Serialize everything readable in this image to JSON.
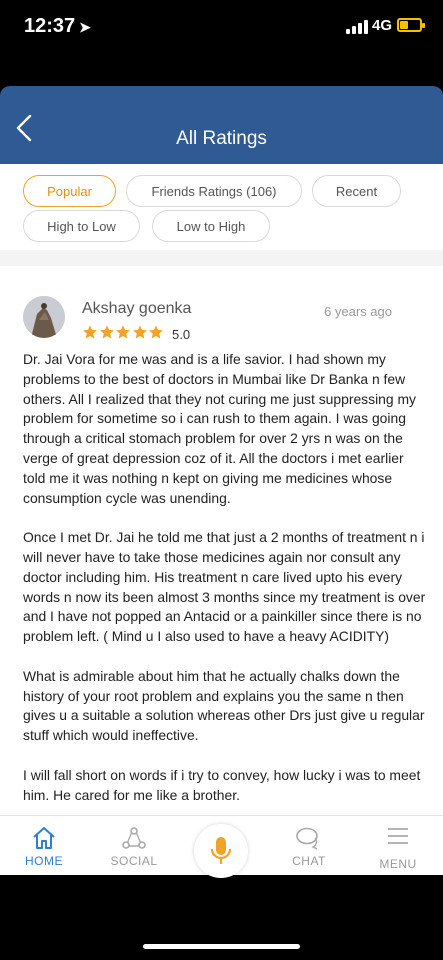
{
  "status_bar": {
    "time": "12:37",
    "network": "4G"
  },
  "header": {
    "title": "All Ratings"
  },
  "filters": [
    {
      "label": "Popular",
      "active": true
    },
    {
      "label": "Friends Ratings (106)",
      "active": false
    },
    {
      "label": "Recent",
      "active": false
    },
    {
      "label": "High to Low",
      "active": false
    },
    {
      "label": "Low to High",
      "active": false
    }
  ],
  "review": {
    "reviewer_name": "Akshay goenka",
    "date": "6 years ago",
    "rating": "5.0",
    "stars": 5,
    "paragraphs": [
      "Dr. Jai Vora for me was and is a life savior. I had shown my problems to the best of doctors in Mumbai like Dr Banka n few others. All I realized that they not curing me just suppressing my problem for sometime so i can rush to them again. I was going through a critical stomach problem for over 2 yrs n was on the verge of great depression coz of it. All the doctors i met earlier told me it was nothing n kept on giving me medicines whose consumption cycle was unending.",
      "Once I met Dr. Jai he told me that just a 2 months of treatment n i will never have to take those medicines again nor consult any doctor including him. His treatment n care lived upto his every words n now its been almost 3 months since my treatment is over and I have not popped an Antacid or a painkiller since there is no problem left. ( Mind u I also used to have a heavy ACIDITY)",
      "What is admirable about him that he actually chalks down the history of your root problem and explains you the same n then gives u a suitable a solution whereas other Drs just give u regular stuff which would ineffective.",
      "I will fall short on words if i try to convey, how lucky i was to meet him. He cared for me like a brother."
    ]
  },
  "bottom_nav": {
    "home": "HOME",
    "social": "SOCIAL",
    "chat": "CHAT",
    "menu": "MENU"
  },
  "colors": {
    "header_bg": "#2f5a94",
    "accent_orange": "#f0a326",
    "active_nav": "#2f7fd0"
  }
}
